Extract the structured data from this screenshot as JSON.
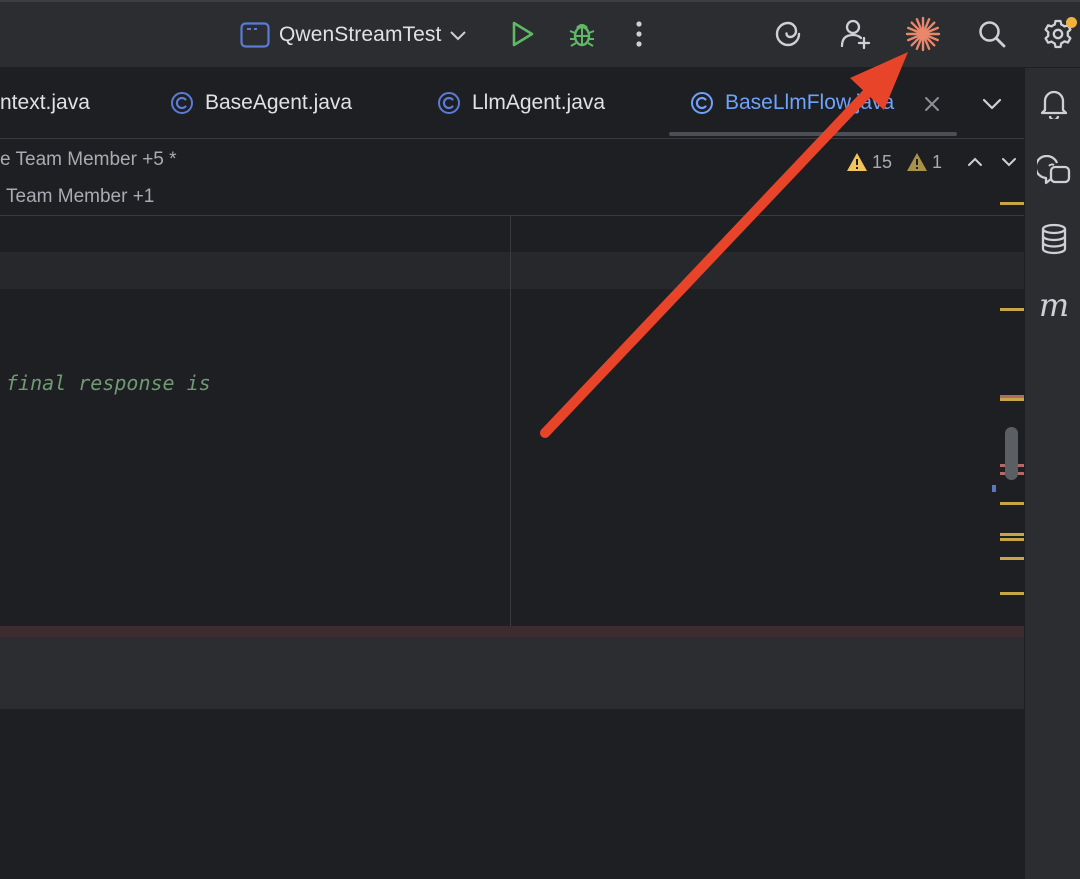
{
  "toolbar": {
    "run_configuration": "QwenStreamTest"
  },
  "tabs": [
    {
      "label": "ntext.java",
      "active": false
    },
    {
      "label": "BaseAgent.java",
      "active": false
    },
    {
      "label": "LlmAgent.java",
      "active": false
    },
    {
      "label": "BaseLlmFlow.java",
      "active": true
    }
  ],
  "editor": {
    "inlay_authors_1": "e Team Member +5 *",
    "inlay_authors_2": "Team Member +1",
    "warnings_count": "15",
    "weak_warnings_count": "1",
    "code_comment": "final response is"
  },
  "colors": {
    "accent_tab": "#6fa2fa",
    "run_green": "#5fb865",
    "ai_icon": "#e8876b",
    "warning_yellow": "#f2c55c",
    "annotation_arrow": "#e8442a",
    "notification_dot": "#f2b33d"
  },
  "icons": {
    "run": "play-icon",
    "debug": "bug-icon",
    "more": "more-vertical-icon",
    "ai_assistant": "spiral-icon",
    "add_user": "add-user-icon",
    "ai_spark": "sparkle-icon",
    "search": "search-icon",
    "settings": "gear-icon",
    "notifications": "bell-icon",
    "chat": "chat-icon",
    "database": "database-icon",
    "maven": "maven-icon"
  }
}
